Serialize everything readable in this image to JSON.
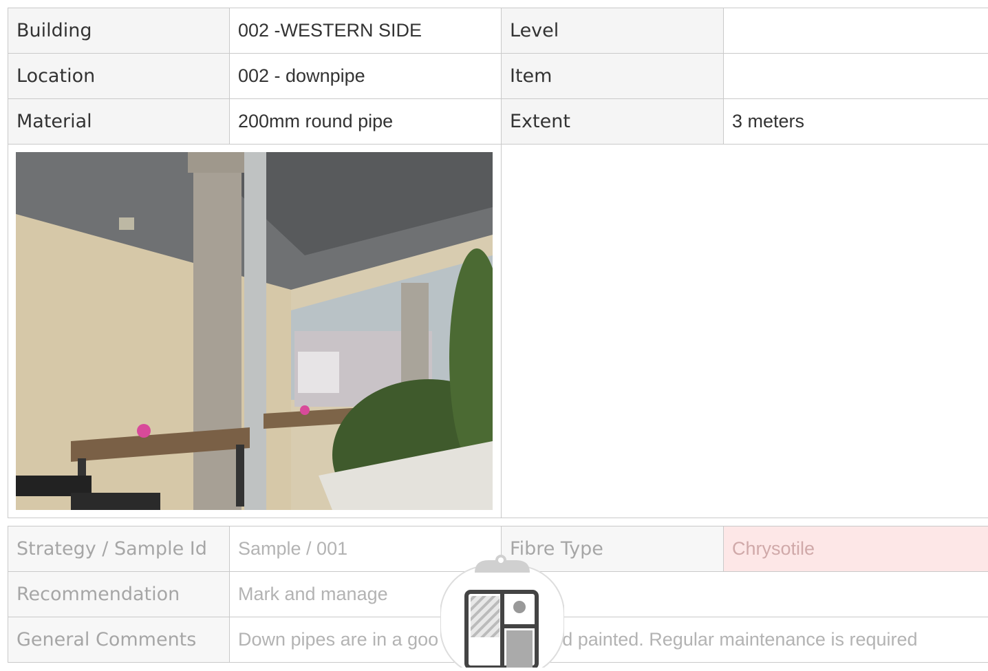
{
  "rows": {
    "building": {
      "label": "Building",
      "value": "002 -WESTERN SIDE"
    },
    "level": {
      "label": "Level",
      "value": ""
    },
    "location": {
      "label": "Location",
      "value": "002 - downpipe"
    },
    "item": {
      "label": "Item",
      "value": ""
    },
    "material": {
      "label": "Material",
      "value": "200mm round pipe"
    },
    "extent": {
      "label": "Extent",
      "value": "3 meters"
    },
    "strategy": {
      "label": "Strategy / Sample Id",
      "value": "Sample / 001"
    },
    "fibre": {
      "label": "Fibre Type",
      "value": "Chrysotile"
    },
    "recommendation": {
      "label": "Recommendation",
      "value": "Mark and manage"
    },
    "comments": {
      "label": "General Comments",
      "value": "Down pipes are in a goo",
      "value_tail": "d painted. Regular maintenance is required"
    }
  },
  "colors": {
    "fibre_bg": "#fde7e7",
    "border": "#c9c9c9"
  },
  "icons": {
    "overlay": "clipboard-icon"
  }
}
